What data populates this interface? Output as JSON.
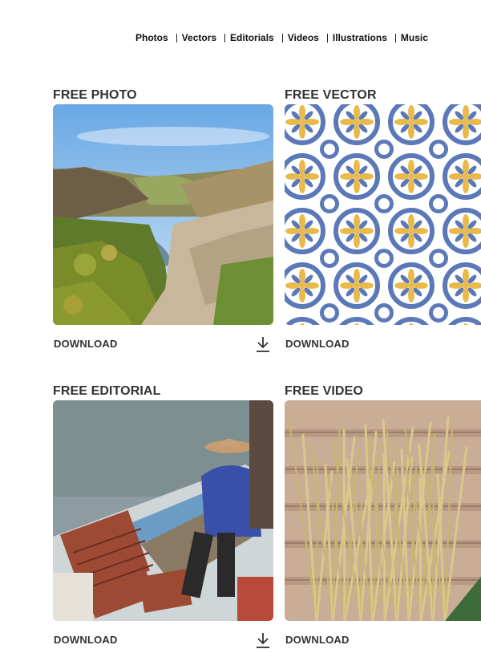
{
  "nav": {
    "items": [
      "Photos",
      "Vectors",
      "Editorials",
      "Videos",
      "Illustrations",
      "Music"
    ]
  },
  "cards": [
    {
      "title": "FREE PHOTO",
      "download": "DOWNLOAD"
    },
    {
      "title": "FREE VECTOR",
      "download": "DOWNLOAD"
    },
    {
      "title": "FREE EDITORIAL",
      "download": "DOWNLOAD"
    },
    {
      "title": "FREE VIDEO",
      "download": "DOWNLOAD"
    }
  ],
  "icons": {
    "download": "download-arrow-icon"
  },
  "colors": {
    "text": "#333333",
    "pattern_blue": "#5b78b8",
    "pattern_yellow": "#e9b949"
  }
}
